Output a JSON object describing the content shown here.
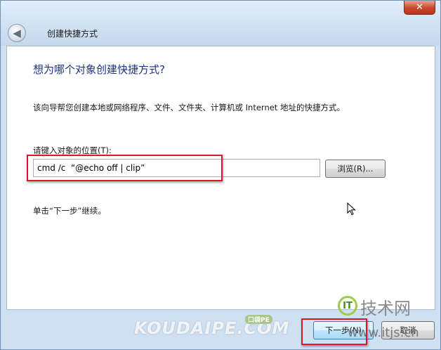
{
  "window": {
    "title": "创建快捷方式",
    "close_glyph": "✕",
    "back_glyph": "◀"
  },
  "content": {
    "heading": "想为哪个对象创建快捷方式?",
    "description": "该向导帮您创建本地或网络程序、文件、文件夹、计算机或 Internet 地址的快捷方式。",
    "location_label": "请键入对象的位置(T):",
    "location_value": "cmd /c  “@echo off | clip”",
    "browse_label": "浏览(R)...",
    "hint": "单击“下一步”继续。"
  },
  "footer": {
    "next_label": "下一步(N)",
    "cancel_label": "取消"
  },
  "watermarks": {
    "koudai": "KOUDAIPE.COM",
    "koudai_badge": "口袋PE",
    "itjs_badge": "IT",
    "itjs_text": "技术网",
    "itjs_url": "www.itjs.cn"
  },
  "colors": {
    "heading": "#1e3287",
    "highlight": "#e0142a",
    "close_button": "#c9462c"
  }
}
